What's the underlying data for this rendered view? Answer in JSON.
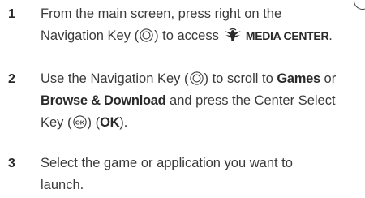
{
  "steps": [
    {
      "number": "1",
      "line1": "From the main screen, press right on the",
      "line2_a": "Navigation Key (",
      "line2_b": ") to access",
      "keyword": "MEDIA CENTER",
      "line2_end": "."
    },
    {
      "number": "2",
      "line1_a": "Use the Navigation Key (",
      "line1_b": ") to scroll to",
      "kw_games": "Games",
      "line1_c": "or",
      "kw_browse": "Browse & Download",
      "line2_a": "and press the Center Select",
      "line3_a": "Key (",
      "line3_b": ") (",
      "kw_ok": "OK",
      "line3_c": ")."
    },
    {
      "number": "3",
      "line1": "Select the game or application you want to",
      "line2": "launch."
    }
  ],
  "icons": {
    "navigation_key": "navigation-key-icon",
    "media_center": "media-center-icon",
    "center_select_key": "ok-key-icon"
  }
}
